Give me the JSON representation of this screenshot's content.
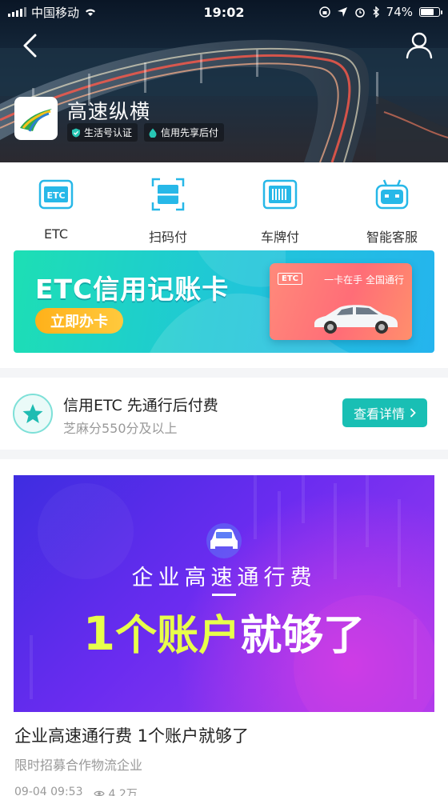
{
  "status_bar": {
    "carrier": "中国移动",
    "time": "19:02",
    "battery": "74%"
  },
  "header": {
    "app_name": "高速纵横",
    "badges": [
      "生活号认证",
      "信用先享后付"
    ]
  },
  "quick_actions": [
    {
      "label": "ETC",
      "icon": "etc-icon"
    },
    {
      "label": "扫码付",
      "icon": "scan-icon"
    },
    {
      "label": "车牌付",
      "icon": "license-plate-icon"
    },
    {
      "label": "智能客服",
      "icon": "robot-icon"
    }
  ],
  "etc_banner": {
    "title": "ETC信用记账卡",
    "cta": "立即办卡",
    "card_chip": "ETC",
    "card_slogan": "一卡在手 全国通行"
  },
  "credit_etc": {
    "title": "信用ETC 先通行后付费",
    "subtitle": "芝麻分550分及以上",
    "button": "查看详情"
  },
  "article": {
    "banner_sub": "企业高速通行费",
    "banner_big_num": "1",
    "banner_big_yellow": "个账户",
    "banner_big_white": "就够了",
    "title": "企业高速通行费 1个账户就够了",
    "subtitle": "限时招募合作物流企业",
    "date": "09-04 09:53",
    "views": "4.2万"
  }
}
